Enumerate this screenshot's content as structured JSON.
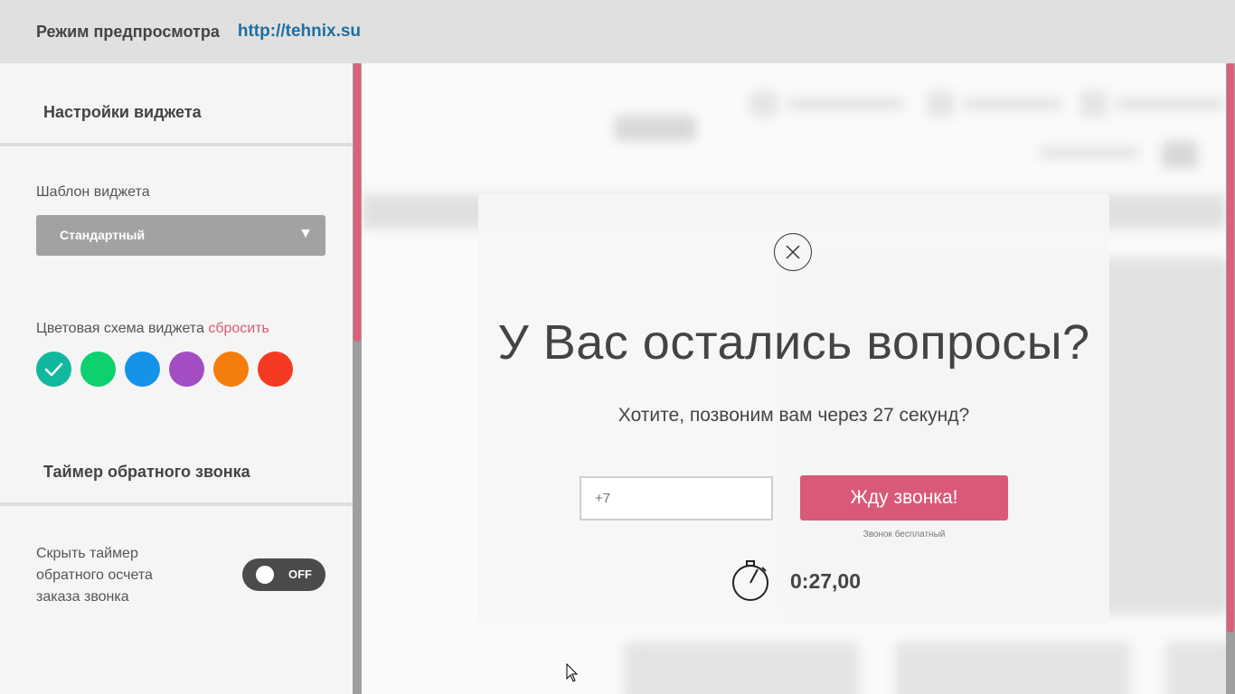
{
  "topbar": {
    "mode_label": "Режим предпросмотра",
    "url": "http://tehnix.su"
  },
  "sidebar": {
    "section1_title": "Настройки виджета",
    "template_label": "Шаблон виджета",
    "template_value": "Стандартный",
    "color_label": "Цветовая схема виджета",
    "color_reset": "сбросить",
    "colors": [
      "#12b89e",
      "#0cd16e",
      "#1493e8",
      "#a24ec2",
      "#f47d0b",
      "#f43a22"
    ],
    "selected_color": "#12b89e",
    "section2_title": "Таймер обратного звонка",
    "hide_timer_label": [
      "Скрыть таймер",
      "обратного осчета",
      "заказа звонка"
    ],
    "toggle_state": "OFF"
  },
  "modal": {
    "title": "У Вас остались вопросы?",
    "subtitle": "Хотите, позвоним вам через 27 секунд?",
    "phone_placeholder": "+7",
    "call_button": "Жду звонка!",
    "free_note": "Звонок бесплатный",
    "timer": "0:27,00"
  },
  "accent_color": "#d95a78"
}
